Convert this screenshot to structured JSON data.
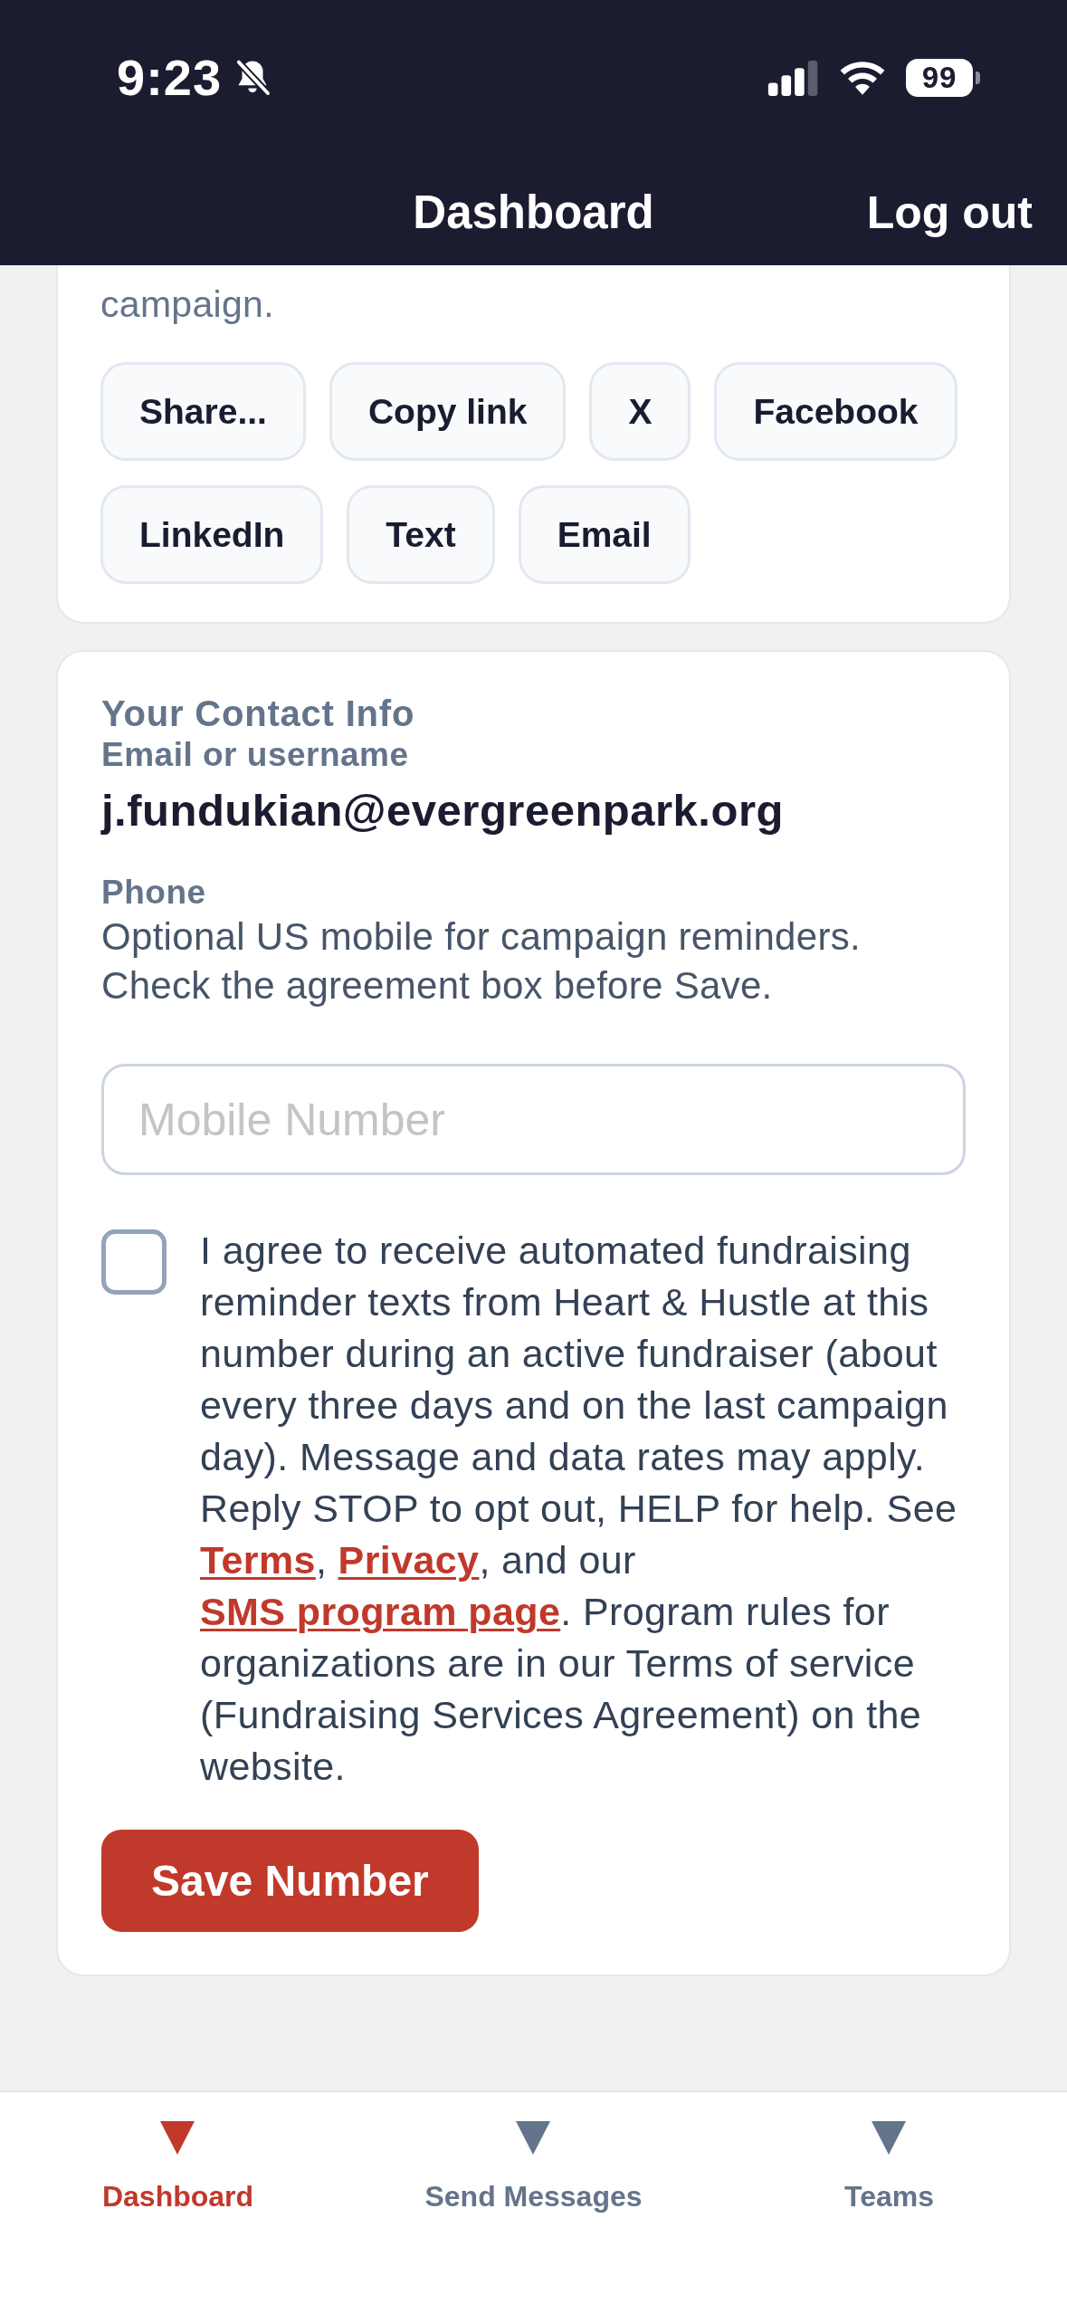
{
  "status_bar": {
    "time": "9:23",
    "battery": "99"
  },
  "header": {
    "title": "Dashboard",
    "action": "Log out"
  },
  "share_card": {
    "text": "campaign.",
    "buttons": [
      "Share...",
      "Copy link",
      "X",
      "Facebook",
      "LinkedIn",
      "Text",
      "Email"
    ]
  },
  "contact_card": {
    "title": "Your Contact Info",
    "email_label": "Email or username",
    "email": "j.fundukian@evergreenpark.org",
    "phone_label": "Phone",
    "phone_help": [
      "Optional US mobile for campaign reminders.",
      "Check the agreement box before Save."
    ],
    "mobile_field": {
      "placeholder": "Mobile Number"
    },
    "consent": {
      "checked": false,
      "parts": [
        {
          "kind": "text",
          "text": "I agree to receive automated fundraising reminder texts from Heart & Hustle at this number during an active fundraiser (about every three days and on the last campaign day). Message and data rates may apply. Reply STOP to opt out, HELP for help. See "
        },
        {
          "kind": "link",
          "text": "Terms"
        },
        {
          "kind": "text",
          "text": ", "
        },
        {
          "kind": "link",
          "text": "Privacy"
        },
        {
          "kind": "text",
          "text": ", and our "
        },
        {
          "kind": "link",
          "text": "SMS program page"
        },
        {
          "kind": "text",
          "text": ". Program rules for organizations are in our Terms of service (Fundraising Services Agreement) on the website."
        }
      ]
    },
    "save_button": "Save Number"
  },
  "nav_tabs": [
    {
      "label": "Dashboard",
      "selected": true
    },
    {
      "label": "Send Messages",
      "selected": false
    },
    {
      "label": "Teams",
      "selected": false
    }
  ]
}
